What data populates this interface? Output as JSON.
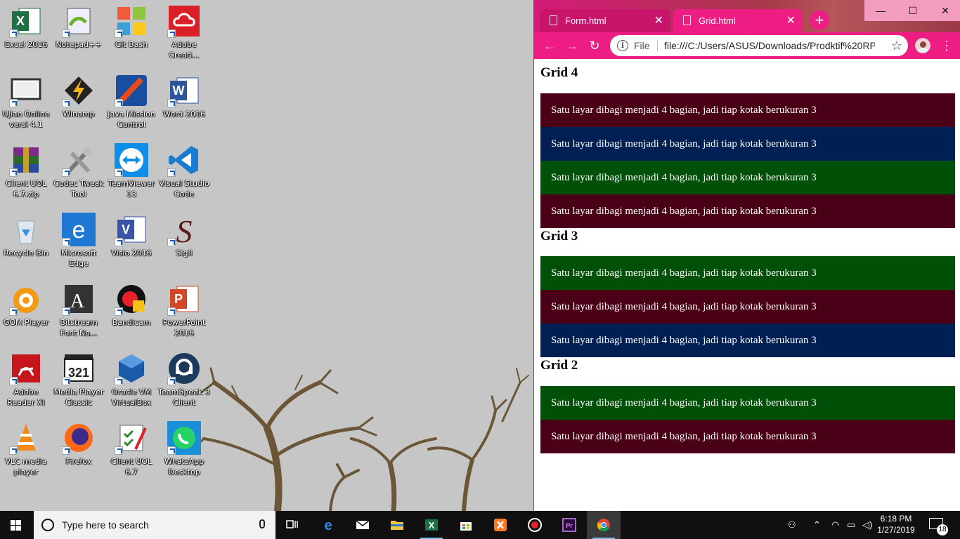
{
  "desktop": {
    "icons": [
      {
        "label": "Excel 2016"
      },
      {
        "label": "Notepad++"
      },
      {
        "label": "Git Bash"
      },
      {
        "label": "Adobe Creati..."
      },
      {
        "label": "Ujian Online versi 4.1"
      },
      {
        "label": "Winamp"
      },
      {
        "label": "Java Mission Control"
      },
      {
        "label": "Word 2016"
      },
      {
        "label": "Client UOL 6.7.zip"
      },
      {
        "label": "Codec Tweak Tool"
      },
      {
        "label": "TeamViewer 13"
      },
      {
        "label": "Visual Studio Code"
      },
      {
        "label": "Recycle Bin"
      },
      {
        "label": "Microsoft Edge"
      },
      {
        "label": "Visio 2016"
      },
      {
        "label": "Sigil"
      },
      {
        "label": "GOM Player"
      },
      {
        "label": "Bitstream Font Na..."
      },
      {
        "label": "Bandicam"
      },
      {
        "label": "PowerPoint 2016"
      },
      {
        "label": "Adobe Reader XI"
      },
      {
        "label": "Media Player Classic"
      },
      {
        "label": "Oracle VM VirtualBox"
      },
      {
        "label": "TeamSpeak 3 Client"
      },
      {
        "label": "VLC media player"
      },
      {
        "label": "Firefox"
      },
      {
        "label": "Client UOL 6.7"
      },
      {
        "label": "WhatsApp Desktop"
      }
    ]
  },
  "browser": {
    "tabs": [
      {
        "label": "Form.html",
        "close": "✕"
      },
      {
        "label": "Grid.html",
        "close": "✕"
      }
    ],
    "new_tab": "+",
    "window_buttons": {
      "minimize": "—",
      "maximize": "☐",
      "close": "✕"
    },
    "nav": {
      "back": "←",
      "forward": "→",
      "reload": "↻"
    },
    "omnibox": {
      "info": "i",
      "scheme": "File",
      "url": "file:///C:/Users/ASUS/Downloads/Prodktif%20RP...",
      "star": "☆"
    },
    "menu": "⋮",
    "content": {
      "sections": [
        {
          "title": "Grid 4",
          "boxes": [
            {
              "text": "Satu layar dibagi menjadi 4 bagian, jadi tiap kotak berukuran 3",
              "color": "#4a0017"
            },
            {
              "text": "Satu layar dibagi menjadi 4 bagian, jadi tiap kotak berukuran 3",
              "color": "#002054"
            },
            {
              "text": "Satu layar dibagi menjadi 4 bagian, jadi tiap kotak berukuran 3",
              "color": "#005008"
            },
            {
              "text": "Satu layar dibagi menjadi 4 bagian, jadi tiap kotak berukuran 3",
              "color": "#4a0017"
            }
          ]
        },
        {
          "title": "Grid 3",
          "boxes": [
            {
              "text": "Satu layar dibagi menjadi 4 bagian, jadi tiap kotak berukuran 3",
              "color": "#005008"
            },
            {
              "text": "Satu layar dibagi menjadi 4 bagian, jadi tiap kotak berukuran 3",
              "color": "#4a0017"
            },
            {
              "text": "Satu layar dibagi menjadi 4 bagian, jadi tiap kotak berukuran 3",
              "color": "#002054"
            }
          ]
        },
        {
          "title": "Grid 2",
          "boxes": [
            {
              "text": "Satu layar dibagi menjadi 4 bagian, jadi tiap kotak berukuran 3",
              "color": "#005008"
            },
            {
              "text": "Satu layar dibagi menjadi 4 bagian, jadi tiap kotak berukuran 3",
              "color": "#4a0017"
            }
          ]
        }
      ]
    }
  },
  "taskbar": {
    "search_placeholder": "Type here to search",
    "apps": [
      "task-view",
      "edge",
      "mail",
      "file-explorer",
      "excel",
      "store",
      "xampp",
      "bandicam",
      "premiere",
      "chrome"
    ],
    "clock": {
      "time": "6:18 PM",
      "date": "1/27/2019"
    },
    "notification_count": "18"
  }
}
